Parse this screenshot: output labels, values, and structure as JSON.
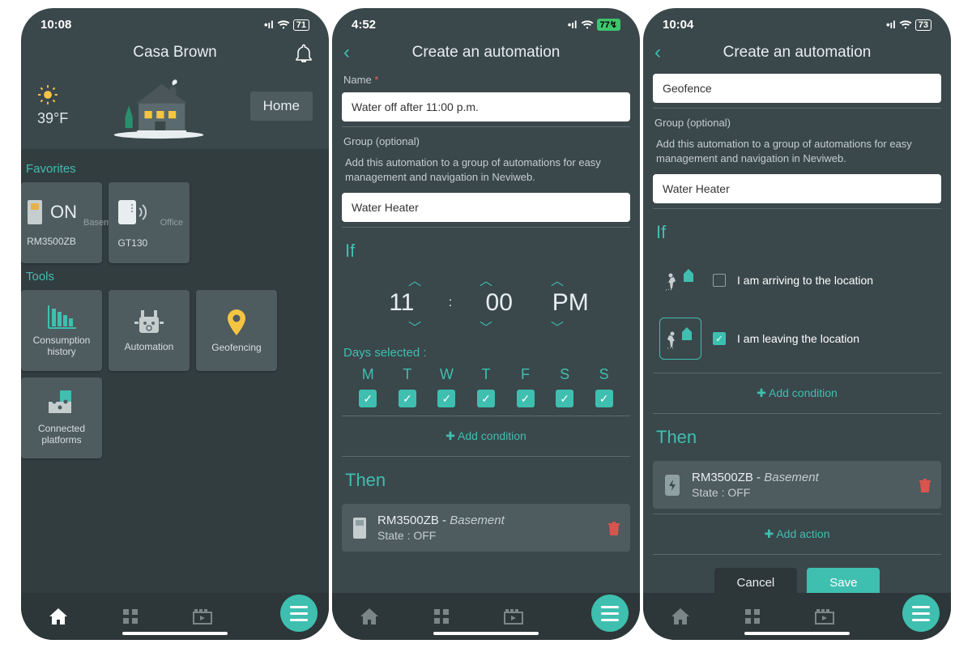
{
  "s1": {
    "time": "10:08",
    "bat": "71",
    "title": "Casa Brown",
    "temp": "39°F",
    "homebtn": "Home",
    "favLabel": "Favorites",
    "toolsLabel": "Tools",
    "fav": [
      {
        "name": "RM3500ZB",
        "loc": "Basement",
        "state": "ON"
      },
      {
        "name": "GT130",
        "loc": "Office"
      }
    ],
    "tools": [
      "Consumption history",
      "Automation",
      "Geofencing",
      "Connected platforms"
    ]
  },
  "s2": {
    "time": "4:52",
    "bat": "77",
    "title": "Create an automation",
    "nameLbl": "Name",
    "nameVal": "Water off after 11:00 p.m.",
    "groupLbl": "Group (optional)",
    "groupHint": "Add this automation to a group of automations for easy management and navigation in Neviweb.",
    "groupVal": "Water Heater",
    "if": "If",
    "hh": "11",
    "mm": "00",
    "ap": "PM",
    "daysLbl": "Days selected :",
    "days": [
      "M",
      "T",
      "W",
      "T",
      "F",
      "S",
      "S"
    ],
    "addcond": "Add condition",
    "then": "Then",
    "act": {
      "dev": "RM3500ZB",
      "loc": "Basement",
      "state": "State : OFF"
    }
  },
  "s3": {
    "time": "10:04",
    "bat": "73",
    "title": "Create an automation",
    "nameVal": "Geofence",
    "groupLbl": "Group (optional)",
    "groupHint": "Add this automation to a group of automations for easy management and navigation in Neviweb.",
    "groupVal": "Water Heater",
    "if": "If",
    "arrive": "I am arriving to the location",
    "leave": "I am leaving the location",
    "addcond": "Add condition",
    "then": "Then",
    "act": {
      "dev": "RM3500ZB",
      "loc": "Basement",
      "state": "State : OFF"
    },
    "addact": "Add action",
    "cancel": "Cancel",
    "save": "Save"
  }
}
